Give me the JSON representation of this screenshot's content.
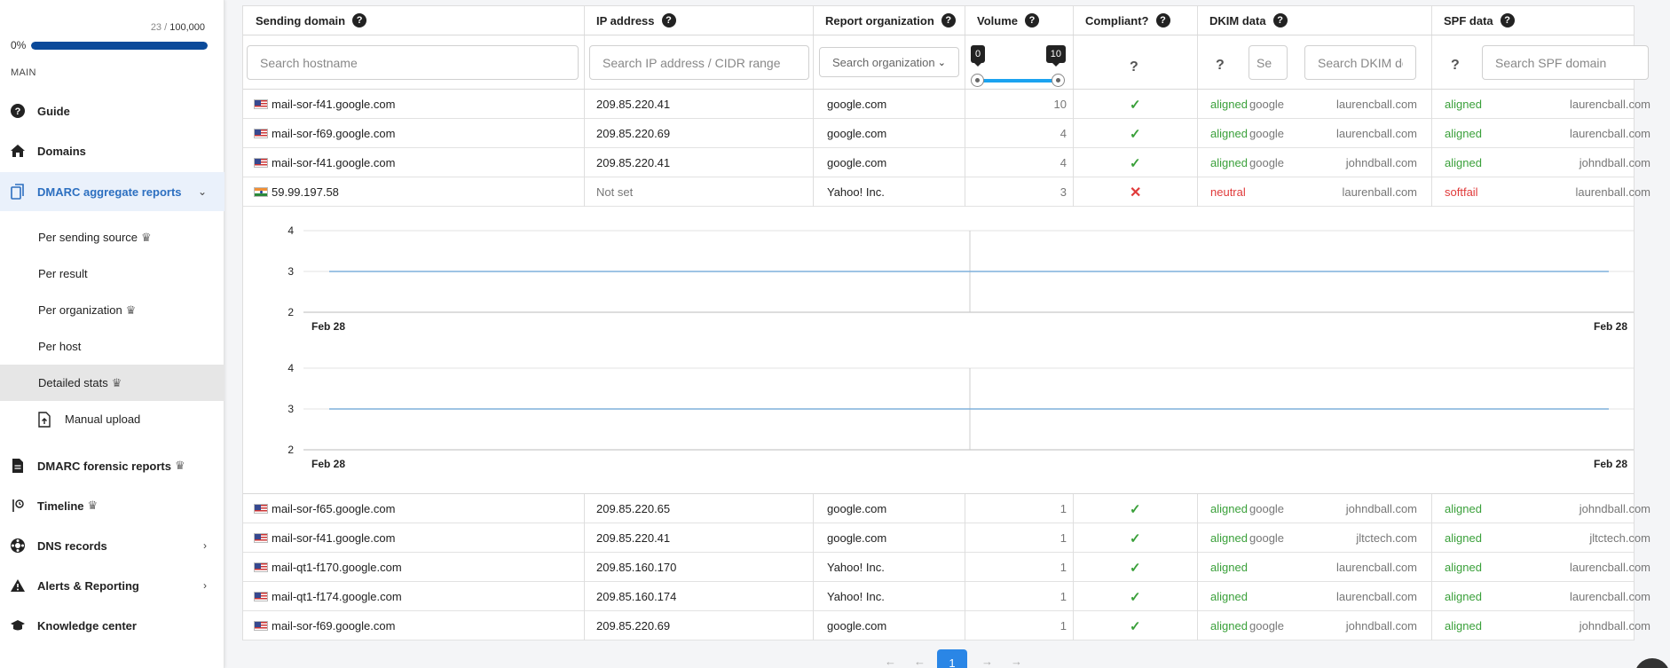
{
  "sidebar": {
    "quota_used": "23",
    "quota_total": "100,000",
    "progress_label": "0%",
    "progress_value": 0.02,
    "section": "MAIN",
    "items": [
      {
        "label": "Guide"
      },
      {
        "label": "Domains"
      },
      {
        "label": "DMARC aggregate reports"
      },
      {
        "label": "DMARC forensic reports"
      },
      {
        "label": "Timeline"
      },
      {
        "label": "DNS records"
      },
      {
        "label": "Alerts & Reporting"
      },
      {
        "label": "Knowledge center"
      }
    ],
    "sub_items": [
      {
        "label": "Per sending source"
      },
      {
        "label": "Per result"
      },
      {
        "label": "Per organization"
      },
      {
        "label": "Per host"
      },
      {
        "label": "Detailed stats"
      },
      {
        "label": "Manual upload"
      }
    ],
    "colors": {
      "accent": "#2c6fc0",
      "progress": "#0b4a9a"
    }
  },
  "table": {
    "headers": {
      "sending_domain": "Sending domain",
      "ip": "IP address",
      "org": "Report organization",
      "volume": "Volume",
      "compliant": "Compliant?",
      "dkim": "DKIM data",
      "spf": "SPF data"
    },
    "filters": {
      "hostname_placeholder": "Search hostname",
      "ip_placeholder": "Search IP address / CIDR range",
      "org_placeholder": "Search organization",
      "dkim_selector_placeholder": "Se",
      "dkim_domain_placeholder": "Search DKIM do",
      "spf_domain_placeholder": "Search SPF domain",
      "volume_min": "0",
      "volume_max": "10",
      "unknown_mark": "?"
    },
    "rows_top": [
      {
        "flag": "us",
        "host": "mail-sor-f41.google.com",
        "ip": "209.85.220.41",
        "org": "google.com",
        "volume": "10",
        "compliant": true,
        "dkim_result": "aligned",
        "dkim_selector": "google",
        "dkim_domain": "laurencball.com",
        "spf_result": "aligned",
        "spf_domain": "laurencball.com"
      },
      {
        "flag": "us",
        "host": "mail-sor-f69.google.com",
        "ip": "209.85.220.69",
        "org": "google.com",
        "volume": "4",
        "compliant": true,
        "dkim_result": "aligned",
        "dkim_selector": "google",
        "dkim_domain": "laurencball.com",
        "spf_result": "aligned",
        "spf_domain": "laurencball.com"
      },
      {
        "flag": "us",
        "host": "mail-sor-f41.google.com",
        "ip": "209.85.220.41",
        "org": "google.com",
        "volume": "4",
        "compliant": true,
        "dkim_result": "aligned",
        "dkim_selector": "google",
        "dkim_domain": "johndball.com",
        "spf_result": "aligned",
        "spf_domain": "johndball.com"
      },
      {
        "flag": "in",
        "host": "59.99.197.58",
        "ip": "Not set",
        "org": "Yahoo! Inc.",
        "volume": "3",
        "compliant": false,
        "dkim_result": "neutral",
        "dkim_selector": "",
        "dkim_domain": "laurenball.com",
        "spf_result": "softfail",
        "spf_domain": "laurenball.com"
      }
    ],
    "rows_bottom": [
      {
        "flag": "us",
        "host": "mail-sor-f65.google.com",
        "ip": "209.85.220.65",
        "org": "google.com",
        "volume": "1",
        "compliant": true,
        "dkim_result": "aligned",
        "dkim_selector": "google",
        "dkim_domain": "johndball.com",
        "spf_result": "aligned",
        "spf_domain": "johndball.com"
      },
      {
        "flag": "us",
        "host": "mail-sor-f41.google.com",
        "ip": "209.85.220.41",
        "org": "google.com",
        "volume": "1",
        "compliant": true,
        "dkim_result": "aligned",
        "dkim_selector": "google",
        "dkim_domain": "jltctech.com",
        "spf_result": "aligned",
        "spf_domain": "jltctech.com"
      },
      {
        "flag": "us",
        "host": "mail-qt1-f170.google.com",
        "ip": "209.85.160.170",
        "org": "Yahoo! Inc.",
        "volume": "1",
        "compliant": true,
        "dkim_result": "aligned",
        "dkim_selector": "",
        "dkim_domain": "laurencball.com",
        "spf_result": "aligned",
        "spf_domain": "laurencball.com"
      },
      {
        "flag": "us",
        "host": "mail-qt1-f174.google.com",
        "ip": "209.85.160.174",
        "org": "Yahoo! Inc.",
        "volume": "1",
        "compliant": true,
        "dkim_result": "aligned",
        "dkim_selector": "",
        "dkim_domain": "laurencball.com",
        "spf_result": "aligned",
        "spf_domain": "laurencball.com"
      },
      {
        "flag": "us",
        "host": "mail-sor-f69.google.com",
        "ip": "209.85.220.69",
        "org": "google.com",
        "volume": "1",
        "compliant": true,
        "dkim_result": "aligned",
        "dkim_selector": "google",
        "dkim_domain": "johndball.com",
        "spf_result": "aligned",
        "spf_domain": "johndball.com"
      }
    ],
    "colors": {
      "pass": "#3aa03a",
      "fail": "#e03a3a",
      "slider": "#1ba3f0"
    }
  },
  "chart_data": [
    {
      "type": "line",
      "x": [
        "Feb 28",
        "Feb 28"
      ],
      "series": [
        {
          "values": [
            3,
            3
          ]
        }
      ],
      "ylim": [
        2,
        4
      ],
      "yticks": [
        "4",
        "3",
        "2"
      ],
      "grid": true,
      "color": "#7fb0db"
    },
    {
      "type": "line",
      "x": [
        "Feb 28",
        "Feb 28"
      ],
      "series": [
        {
          "values": [
            3,
            3
          ]
        }
      ],
      "ylim": [
        2,
        4
      ],
      "yticks": [
        "4",
        "3",
        "2"
      ],
      "grid": true,
      "color": "#7fb0db"
    }
  ],
  "pager": {
    "prev_first": "←",
    "prev": "←",
    "current": "1",
    "next": "→",
    "next_last": "→"
  }
}
